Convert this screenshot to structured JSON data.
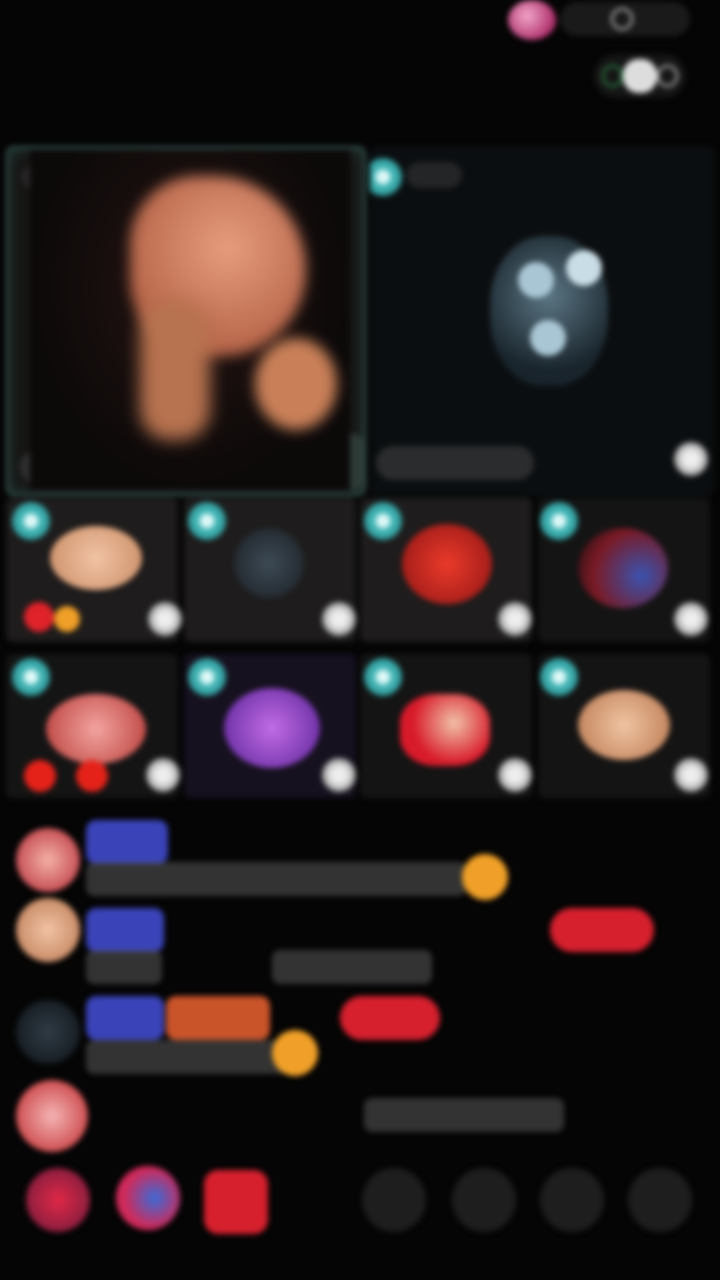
{
  "header": {
    "viewer_count": "",
    "follow_icon": "heart-icon"
  },
  "stage": {
    "host": {
      "name": "",
      "mic_icon": "mic-icon",
      "level_badge": ""
    },
    "guest": {
      "name": "",
      "mic_icon": "mic-icon",
      "level_badge": ""
    }
  },
  "seats": [
    {
      "seat": "",
      "name": "",
      "gift": ""
    },
    {
      "seat": "",
      "name": "",
      "gift": ""
    },
    {
      "seat": "",
      "name": "",
      "gift": ""
    },
    {
      "seat": "",
      "name": "",
      "gift": ""
    },
    {
      "seat": "",
      "name": "",
      "gift": ""
    },
    {
      "seat": "",
      "name": "",
      "gift": ""
    },
    {
      "seat": "",
      "name": "",
      "gift": ""
    },
    {
      "seat": "",
      "name": "",
      "gift": ""
    }
  ],
  "chat": [
    {
      "user": "",
      "message": ""
    },
    {
      "user": "",
      "message": ""
    },
    {
      "user": "",
      "message": ""
    },
    {
      "user": "",
      "message": ""
    }
  ],
  "toolbar": {
    "icons": [
      "gift-box-icon",
      "game-icon",
      "gift-icon",
      "chat-icon",
      "share-icon",
      "mic-toggle-icon",
      "more-icon"
    ]
  },
  "colors": {
    "accent_cyan": "#47bcbc",
    "badge_purple": "#3a43b8",
    "gift_red": "#d6202e",
    "gift_orange": "#f0a028"
  }
}
